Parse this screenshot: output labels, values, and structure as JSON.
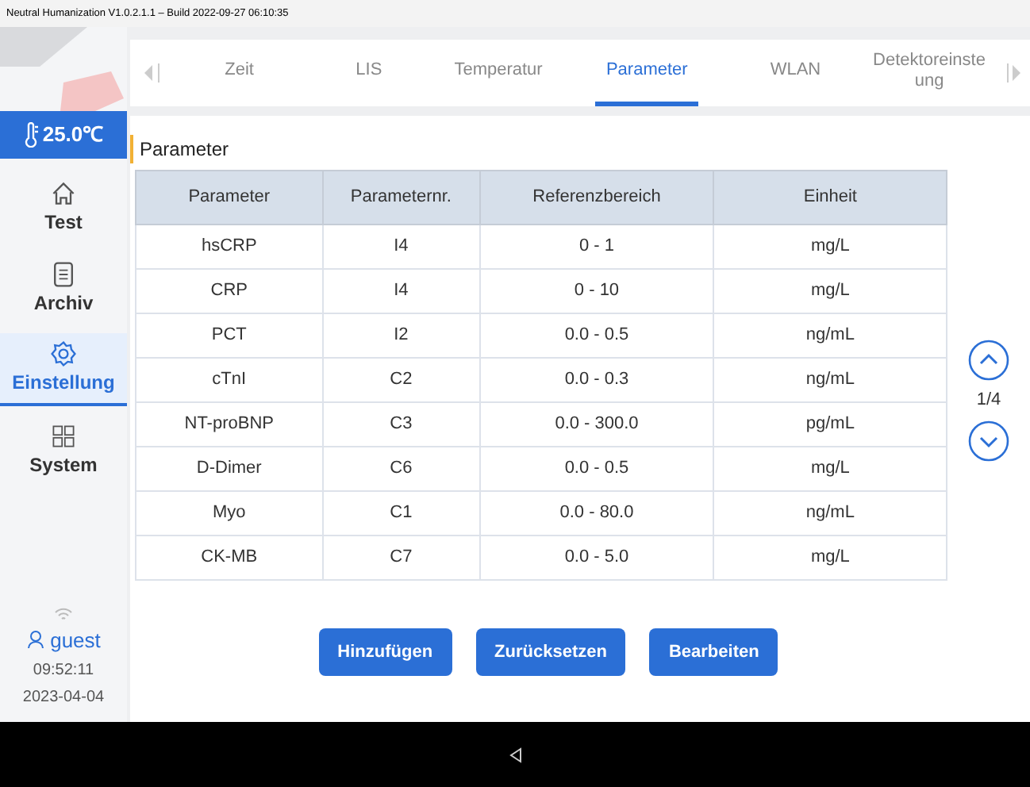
{
  "title_bar": "Neutral Humanization V1.0.2.1.1  – Build 2022-09-27 06:10:35",
  "temperature": "25.0℃",
  "sidebar": {
    "items": [
      {
        "label": "Test",
        "selected": false
      },
      {
        "label": "Archiv",
        "selected": false
      },
      {
        "label": "Einstellung",
        "selected": true
      },
      {
        "label": "System",
        "selected": false
      }
    ],
    "user": "guest",
    "time": "09:52:11",
    "date": "2023-04-04"
  },
  "tabs": [
    {
      "label": "Zeit",
      "selected": false
    },
    {
      "label": "LIS",
      "selected": false
    },
    {
      "label": "Temperatur",
      "selected": false
    },
    {
      "label": "Parameter",
      "selected": true
    },
    {
      "label": "WLAN",
      "selected": false
    },
    {
      "label": "Detektoreinste ung",
      "selected": false
    }
  ],
  "section_title": "Parameter",
  "table": {
    "columns": [
      "Parameter",
      "Parameternr.",
      "Referenzbereich",
      "Einheit"
    ],
    "rows": [
      [
        "hsCRP",
        "I4",
        "0 - 1",
        "mg/L"
      ],
      [
        "CRP",
        "I4",
        "0 - 10",
        "mg/L"
      ],
      [
        "PCT",
        "I2",
        "0.0 - 0.5",
        "ng/mL"
      ],
      [
        "cTnI",
        "C2",
        "0.0 - 0.3",
        "ng/mL"
      ],
      [
        "NT-proBNP",
        "C3",
        "0.0 - 300.0",
        "pg/mL"
      ],
      [
        "D-Dimer",
        "C6",
        "0.0 - 0.5",
        "mg/L"
      ],
      [
        "Myo",
        "C1",
        "0.0 - 80.0",
        "ng/mL"
      ],
      [
        "CK-MB",
        "C7",
        "0.0 - 5.0",
        "mg/L"
      ]
    ]
  },
  "page": "1/4",
  "buttons": [
    "Hinzufügen",
    "Zurücksetzen",
    "Bearbeiten"
  ]
}
